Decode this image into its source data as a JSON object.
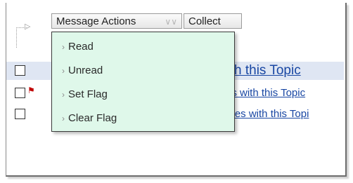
{
  "toolbar": {
    "message_actions_label": "Message Actions",
    "collect_label": "Collect"
  },
  "dropdown": {
    "items": [
      {
        "label": "Read"
      },
      {
        "label": "Unread"
      },
      {
        "label": "Set Flag"
      },
      {
        "label": "Clear Flag"
      }
    ]
  },
  "rows": [
    {
      "link_text": "vith this Topic",
      "flagged": false,
      "highlighted": true
    },
    {
      "link_text": "es with this Topic",
      "flagged": true,
      "highlighted": false
    },
    {
      "link_text": "sues with this Topi",
      "flagged": false,
      "highlighted": false
    }
  ],
  "icons": {
    "chevron": "chevron-down-icon",
    "menu_bullet": "chevron-right-icon",
    "flag": "flag-icon",
    "tree": "tree-connector-icon"
  },
  "colors": {
    "dropdown_bg": "#dff8ea",
    "highlight_row": "#dfe6f3",
    "link": "#1947a3",
    "flag": "#c00000"
  }
}
